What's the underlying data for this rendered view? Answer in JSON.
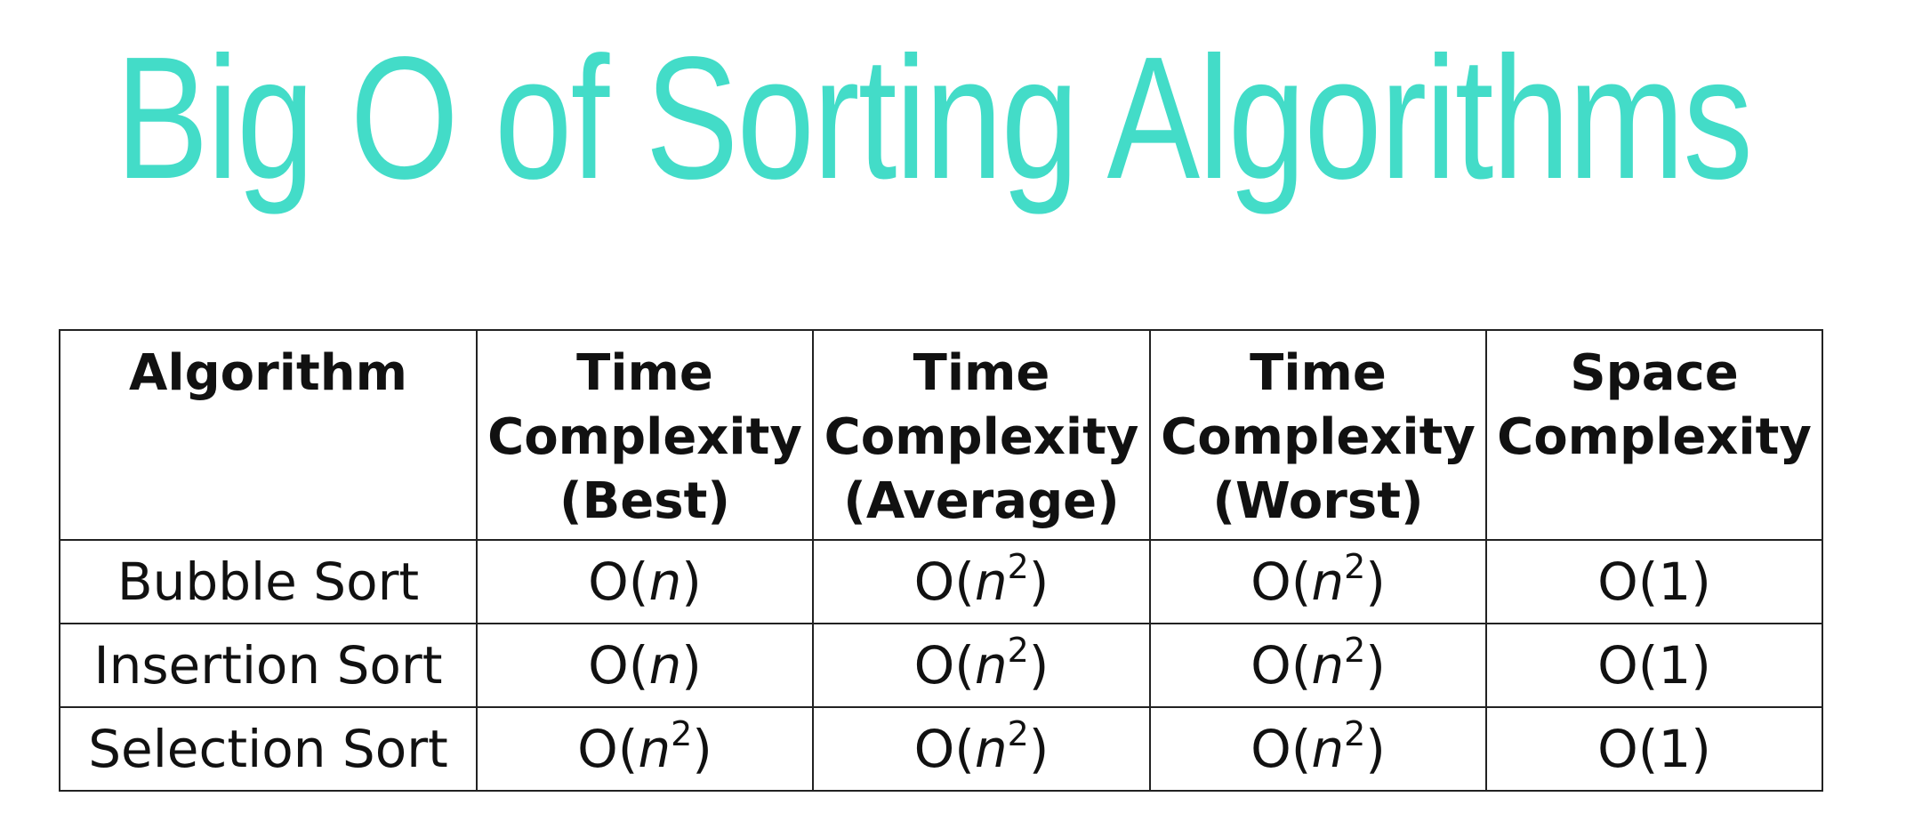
{
  "title": "Big O of Sorting Algorithms",
  "table": {
    "headers": [
      [
        "Algorithm"
      ],
      [
        "Time",
        "Complexity",
        "(Best)"
      ],
      [
        "Time",
        "Complexity",
        "(Average)"
      ],
      [
        "Time",
        "Complexity",
        "(Worst)"
      ],
      [
        "Space",
        "Complexity"
      ]
    ],
    "rows": [
      {
        "algorithm": "Bubble Sort",
        "best": {
          "prefix": "O(",
          "var": "n",
          "exp": "",
          "suffix": ")"
        },
        "average": {
          "prefix": "O(",
          "var": "n",
          "exp": "2",
          "suffix": ")"
        },
        "worst": {
          "prefix": "O(",
          "var": "n",
          "exp": "2",
          "suffix": ")"
        },
        "space": {
          "prefix": "O(1)",
          "var": "",
          "exp": "",
          "suffix": ""
        }
      },
      {
        "algorithm": "Insertion Sort",
        "best": {
          "prefix": "O(",
          "var": "n",
          "exp": "",
          "suffix": ")"
        },
        "average": {
          "prefix": "O(",
          "var": "n",
          "exp": "2",
          "suffix": ")"
        },
        "worst": {
          "prefix": "O(",
          "var": "n",
          "exp": "2",
          "suffix": ")"
        },
        "space": {
          "prefix": "O(1)",
          "var": "",
          "exp": "",
          "suffix": ""
        }
      },
      {
        "algorithm": "Selection Sort",
        "best": {
          "prefix": "O(",
          "var": "n",
          "exp": "2",
          "suffix": ")"
        },
        "average": {
          "prefix": "O(",
          "var": "n",
          "exp": "2",
          "suffix": ")"
        },
        "worst": {
          "prefix": "O(",
          "var": "n",
          "exp": "2",
          "suffix": ")"
        },
        "space": {
          "prefix": "O(1)",
          "var": "",
          "exp": "",
          "suffix": ""
        }
      }
    ]
  },
  "colors": {
    "title": "#43dcc8",
    "text": "#111111",
    "border": "#222222",
    "background": "#ffffff"
  }
}
